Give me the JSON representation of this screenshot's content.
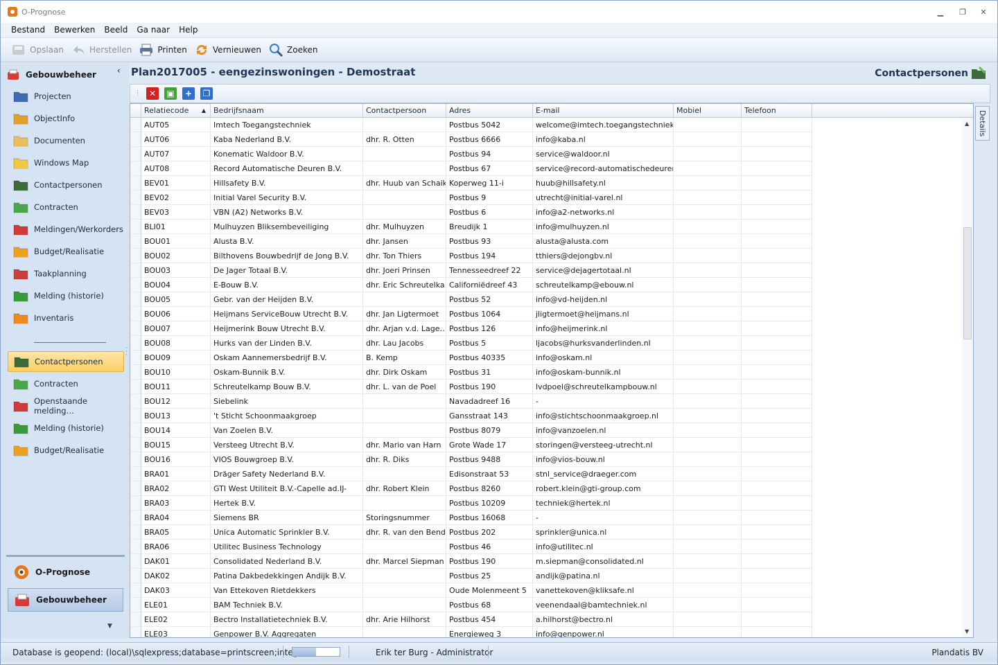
{
  "window": {
    "title": "O-Prognose"
  },
  "menu": [
    "Bestand",
    "Bewerken",
    "Beeld",
    "Ga naar",
    "Help"
  ],
  "toolbar": [
    {
      "label": "Opslaan",
      "icon": "save-icon",
      "enabled": false
    },
    {
      "label": "Herstellen",
      "icon": "undo-icon",
      "enabled": false
    },
    {
      "label": "Printen",
      "icon": "printer-icon",
      "enabled": true
    },
    {
      "label": "Vernieuwen",
      "icon": "refresh-icon",
      "enabled": true
    },
    {
      "label": "Zoeken",
      "icon": "search-icon",
      "enabled": true
    }
  ],
  "nav": {
    "header": "Gebouwbeheer",
    "items": [
      {
        "label": "Projecten",
        "icon": "projects-icon",
        "color": "#3d6bb0"
      },
      {
        "label": "ObjectInfo",
        "icon": "house-icon",
        "color": "#e0a030"
      },
      {
        "label": "Documenten",
        "icon": "folder-icon",
        "color": "#e8c15a"
      },
      {
        "label": "Windows Map",
        "icon": "folder-icon",
        "color": "#f2c744"
      },
      {
        "label": "Contactpersonen",
        "icon": "contacts-folder-icon",
        "color": "#3c6b3a"
      },
      {
        "label": "Contracten",
        "icon": "contracts-folder-icon",
        "color": "#4aa84a"
      },
      {
        "label": "Meldingen/Werkorders",
        "icon": "reports-folder-icon",
        "color": "#d03b3b"
      },
      {
        "label": "Budget/Realisatie",
        "icon": "budget-folder-icon",
        "color": "#f0a020"
      },
      {
        "label": "Taakplanning",
        "icon": "calendar-icon",
        "color": "#c94040"
      },
      {
        "label": "Melding (historie)",
        "icon": "history-icon",
        "color": "#3a9a3a"
      },
      {
        "label": "Inventaris",
        "icon": "inventory-folder-icon",
        "color": "#f08a20"
      }
    ],
    "favorites": [
      {
        "label": "Contactpersonen",
        "icon": "contacts-folder-icon",
        "color": "#3c6b3a",
        "active": true
      },
      {
        "label": "Contracten",
        "icon": "contracts-folder-icon",
        "color": "#4aa84a"
      },
      {
        "label": "Openstaande melding…",
        "icon": "reports-folder-icon",
        "color": "#d03b3b"
      },
      {
        "label": "Melding (historie)",
        "icon": "history-icon",
        "color": "#3a9a3a"
      },
      {
        "label": "Budget/Realisatie",
        "icon": "budget-folder-icon",
        "color": "#f0a020"
      }
    ],
    "modules": [
      {
        "label": "O-Prognose",
        "icon": "oprognose-icon",
        "selected": false
      },
      {
        "label": "Gebouwbeheer",
        "icon": "gebouwbeheer-icon",
        "selected": true
      }
    ]
  },
  "page": {
    "title": "Plan2017005 - eengezinswoningen - Demostraat",
    "section": "Contactpersonen",
    "details_tab": "Details"
  },
  "grid_tools": [
    {
      "icon": "delete-icon",
      "color": "#d42020",
      "glyph": "✕"
    },
    {
      "icon": "window-icon",
      "color": "#4a9e3a",
      "glyph": "▣"
    },
    {
      "icon": "add-icon",
      "color": "#2f6fc8",
      "glyph": "+"
    },
    {
      "icon": "copy-icon",
      "color": "#2f6fc8",
      "glyph": "❐"
    }
  ],
  "grid": {
    "columns": [
      "Relatiecode",
      "Bedrijfsnaam",
      "Contactpersoon",
      "Adres",
      "E-mail",
      "Mobiel",
      "Telefoon"
    ],
    "sort_column": "Relatiecode",
    "rows": [
      [
        "AUT05",
        "Imtech Toegangstechniek",
        "",
        "Postbus 5042",
        "welcome@imtech.toegangstechniek.nl",
        "",
        ""
      ],
      [
        "AUT06",
        "Kaba Nederland B.V.",
        "dhr. R. Otten",
        "Postbus 6666",
        "info@kaba.nl",
        "",
        ""
      ],
      [
        "AUT07",
        "Konematic Waldoor B.V.",
        "",
        "Postbus 94",
        "service@waldoor.nl",
        "",
        ""
      ],
      [
        "AUT08",
        "Record Automatische Deuren B.V.",
        "",
        "Postbus 67",
        "service@record-automatischedeuren.nl",
        "",
        ""
      ],
      [
        "BEV01",
        "Hillsafety B.V.",
        "dhr. Huub van Schaik",
        "Koperweg 11-i",
        "huub@hillsafety.nl",
        "",
        ""
      ],
      [
        "BEV02",
        "Initial Varel Security B.V.",
        "",
        "Postbus 9",
        "utrecht@initial-varel.nl",
        "",
        ""
      ],
      [
        "BEV03",
        "VBN (A2) Networks B.V.",
        "",
        "Postbus 6",
        "info@a2-networks.nl",
        "",
        ""
      ],
      [
        "BLI01",
        "Mulhuyzen Bliksembeveiliging",
        "dhr. Mulhuyzen",
        "Breudijk 1",
        "info@mulhuyzen.nl",
        "",
        ""
      ],
      [
        "BOU01",
        "Alusta B.V.",
        "dhr. Jansen",
        "Postbus 93",
        "alusta@alusta.com",
        "",
        ""
      ],
      [
        "BOU02",
        "Bilthovens Bouwbedrijf de Jong B.V.",
        "dhr. Ton Thiers",
        "Postbus 194",
        "tthiers@dejongbv.nl",
        "",
        ""
      ],
      [
        "BOU03",
        "De Jager Totaal B.V.",
        "dhr. Joeri Prinsen",
        "Tennesseedreef 22",
        "service@dejagertotaal.nl",
        "",
        ""
      ],
      [
        "BOU04",
        "E-Bouw B.V.",
        "dhr. Eric Schreutelka…",
        "Californiëdreef 43",
        "schreutelkamp@ebouw.nl",
        "",
        ""
      ],
      [
        "BOU05",
        "Gebr. van der Heijden B.V.",
        "",
        "Postbus 52",
        "info@vd-heijden.nl",
        "",
        ""
      ],
      [
        "BOU06",
        "Heijmans ServiceBouw Utrecht B.V.",
        "dhr. Jan Ligtermoet",
        "Postbus 1064",
        "jligtermoet@heijmans.nl",
        "",
        ""
      ],
      [
        "BOU07",
        "Heijmerink Bouw Utrecht B.V.",
        "dhr. Arjan v.d. Lage…",
        "Postbus 126",
        "info@heijmerink.nl",
        "",
        ""
      ],
      [
        "BOU08",
        "Hurks van der Linden B.V.",
        "dhr. Lau Jacobs",
        "Postbus 5",
        "ljacobs@hurksvanderlinden.nl",
        "",
        ""
      ],
      [
        "BOU09",
        "Oskam Aannemersbedrijf B.V.",
        "B. Kemp",
        "Postbus 40335",
        "info@oskam.nl",
        "",
        ""
      ],
      [
        "BOU10",
        "Oskam-Bunnik B.V.",
        "dhr. Dirk Oskam",
        "Postbus 31",
        "info@oskam-bunnik.nl",
        "",
        ""
      ],
      [
        "BOU11",
        "Schreutelkamp Bouw B.V.",
        "dhr. L. van de Poel",
        "Postbus 190",
        "lvdpoel@schreutelkampbouw.nl",
        "",
        ""
      ],
      [
        "BOU12",
        "Siebelink",
        "",
        "Navadadreef 16",
        "-",
        "",
        ""
      ],
      [
        "BOU13",
        "'t Sticht Schoonmaakgroep",
        "",
        "Gansstraat 143",
        "info@stichtschoonmaakgroep.nl",
        "",
        ""
      ],
      [
        "BOU14",
        "Van Zoelen B.V.",
        "",
        "Postbus 8079",
        "info@vanzoelen.nl",
        "",
        ""
      ],
      [
        "BOU15",
        "Versteeg Utrecht B.V.",
        "dhr. Mario van Harn",
        "Grote Wade 17",
        "storingen@versteeg-utrecht.nl",
        "",
        ""
      ],
      [
        "BOU16",
        "VIOS Bouwgroep B.V.",
        "dhr. R. Diks",
        "Postbus 9488",
        "info@vios-bouw.nl",
        "",
        ""
      ],
      [
        "BRA01",
        "Dräger Safety Nederland B.V.",
        "",
        "Edisonstraat 53",
        "stnl_service@draeger.com",
        "",
        ""
      ],
      [
        "BRA02",
        "GTI West Utiliteit B.V.-Capelle ad.IJ-",
        "dhr. Robert Klein",
        "Postbus 8260",
        "robert.klein@gti-group.com",
        "",
        ""
      ],
      [
        "BRA03",
        "Hertek B.V.",
        "",
        "Postbus 10209",
        "techniek@hertek.nl",
        "",
        ""
      ],
      [
        "BRA04",
        "Siemens BR",
        "Storingsnummer",
        "Postbus 16068",
        "-",
        "",
        ""
      ],
      [
        "BRA05",
        "Unica Automatic Sprinkler B.V.",
        "dhr. R. van den Bend",
        "Postbus 202",
        "sprinkler@unica.nl",
        "",
        ""
      ],
      [
        "BRA06",
        "Utilitec Business Technology",
        "",
        "Postbus 46",
        "info@utilitec.nl",
        "",
        ""
      ],
      [
        "DAK01",
        "Consolidated Nederland B.V.",
        "dhr. Marcel Siepman",
        "Postbus 190",
        "m.siepman@consolidated.nl",
        "",
        ""
      ],
      [
        "DAK02",
        "Patina Dakbedekkingen Andijk B.V.",
        "",
        "Postbus 25",
        "andijk@patina.nl",
        "",
        ""
      ],
      [
        "DAK03",
        "Van Ettekoven Rietdekkers",
        "",
        "Oude Molenmeent 5",
        "vanettekoven@kliksafe.nl",
        "",
        ""
      ],
      [
        "ELE01",
        "BAM Techniek B.V.",
        "",
        "Postbus 68",
        "veenendaal@bamtechniek.nl",
        "",
        ""
      ],
      [
        "ELE02",
        "Bectro Installatietechniek B.V.",
        "dhr. Arie Hilhorst",
        "Postbus 454",
        "a.hilhorst@bectro.nl",
        "",
        ""
      ],
      [
        "ELE03",
        "Genpower B.V. Aggregaten",
        "",
        "Energieweg 3",
        "info@genpower.nl",
        "",
        ""
      ]
    ]
  },
  "statusbar": {
    "database": "Database is geopend: (local)\\sqlexpress;database=printscreen;integrated",
    "progress": 0.5,
    "user": "Erik ter Burg - Administrator",
    "company": "Plandatis BV"
  }
}
